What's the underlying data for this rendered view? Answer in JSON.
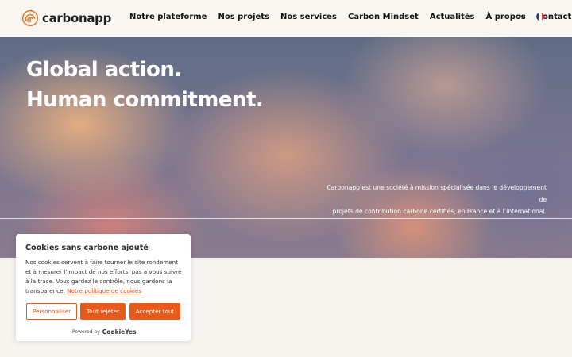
{
  "header": {
    "logo_text": "carbonapp",
    "nav": [
      "Notre plateforme",
      "Nos projets",
      "Nos services",
      "Carbon Mindset",
      "Actualités",
      "À propos",
      "Contact"
    ],
    "language_flag": "fr-flag-icon"
  },
  "hero": {
    "title_line1": "Global action.",
    "title_line2": "Human commitment.",
    "desc_line1": "Carbonapp est une société à mission spécialisée dans le développement de",
    "desc_line2": "projets de contribution carbone certifiés, en France et à l’international."
  },
  "cookie": {
    "title": "Cookies sans carbone ajouté",
    "text": "Nos cookies servent à faire tourner le site rondement et à mesurer l’impact de nos efforts, pas à vous suivre à la trace. Vous gardez le contrôle, nous gardons la transparence.",
    "link": "Notre politique de cookies",
    "btn_customize": "Personnaliser",
    "btn_reject": "Tout rejeter",
    "btn_accept": "Accepter tout",
    "powered_by": "Powered by",
    "brand": "CookieYes"
  },
  "colors": {
    "accent": "#e85a1a",
    "logo_orange": "#e8742a"
  }
}
